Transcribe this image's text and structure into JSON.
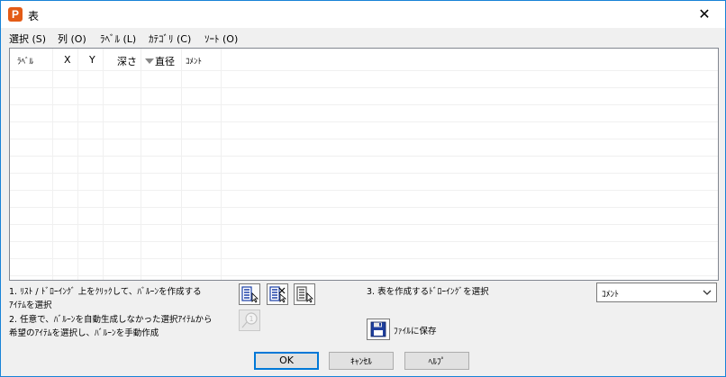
{
  "window": {
    "title": "表",
    "app_icon_letter": "P",
    "close_glyph": "✕"
  },
  "menu": [
    {
      "label": "選択 (S)"
    },
    {
      "label": "列 (O)"
    },
    {
      "label": "ﾗﾍﾞﾙ (L)"
    },
    {
      "label": "ｶﾃｺﾞﾘ (C)"
    },
    {
      "label": "ｿｰﾄ (O)"
    }
  ],
  "table": {
    "columns": [
      "ﾗﾍﾞﾙ",
      "X",
      "Y",
      "深さ",
      "直径",
      "ｺﾒﾝﾄ"
    ],
    "rows": []
  },
  "instructions": {
    "step1_line1": "1. ﾘｽﾄ / ﾄﾞﾛｰｲﾝｸﾞ 上をｸﾘｯｸして、ﾊﾞﾙｰﾝを作成する",
    "step1_line2": "ｱｲﾃﾑを選択",
    "step2_line1": "2. 任意で、ﾊﾞﾙｰﾝを自動生成しなかった選択ｱｲﾃﾑから",
    "step2_line2": "希望のｱｲﾃﾑを選択し、ﾊﾞﾙｰﾝを手動作成",
    "step3": "3. 表を作成するﾄﾞﾛｰｲﾝｸﾞを選択"
  },
  "combo": {
    "value": "ｺﾒﾝﾄ"
  },
  "save_label": "ﾌｧｲﾙに保存",
  "buttons": {
    "ok": "OK",
    "cancel": "ｷｬﾝｾﾙ",
    "help": "ﾍﾙﾌﾟ"
  },
  "colors": {
    "accent": "#0078d7",
    "border": "#1883d7",
    "icon_orange": "#e35b16"
  }
}
